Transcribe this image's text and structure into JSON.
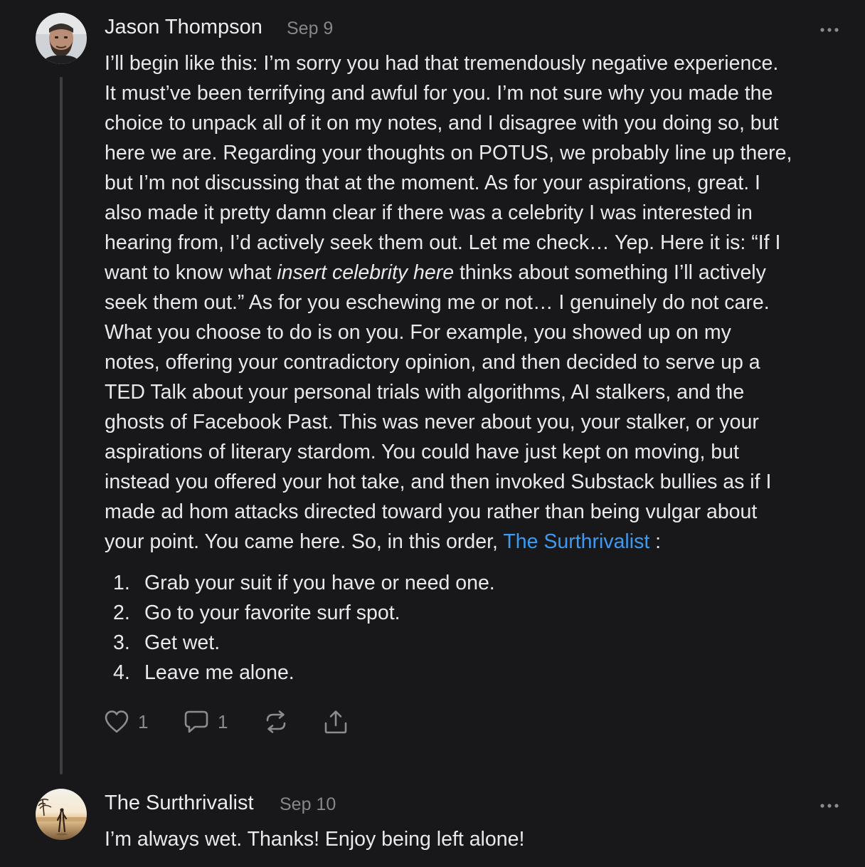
{
  "comments": [
    {
      "author": "Jason Thompson",
      "date": "Sep 9",
      "lines": [
        [
          "I’ll begin like this: I’m sorry you had that tremendously negative experience."
        ],
        [
          "It must’ve been terrifying and awful for you. I’m not sure why you made the"
        ],
        [
          "choice to unpack all of it on my notes, and I disagree with you doing so, but"
        ],
        [
          "here we are. Regarding your thoughts on POTUS, we probably line up there,"
        ],
        [
          "but I’m not discussing that at the moment. As for your aspirations, great. I"
        ],
        [
          "also made it pretty damn clear if there was a celebrity I was interested in"
        ],
        [
          "hearing from, I’d actively seek them out. Let me check… Yep. Here it is: “If I"
        ],
        [
          "want to know what ",
          "insert celebrity here",
          " thinks about something I’ll actively"
        ],
        [
          "seek them out.” As for you eschewing me or not… I genuinely do not care."
        ],
        [
          "What you choose to do is on you. For example, you showed up on my"
        ],
        [
          "notes, offering your contradictory opinion, and then decided to serve up a"
        ],
        [
          "TED Talk about your personal trials with algorithms, AI stalkers, and the"
        ],
        [
          "ghosts of Facebook Past. This was never about you, your stalker, or your"
        ],
        [
          "aspirations of literary stardom. You could have just kept on moving, but"
        ],
        [
          "instead you offered your hot take, and then invoked Substack bullies as if I"
        ],
        [
          "made ad hom attacks directed toward you rather than being vulgar about"
        ],
        [
          "your point. You came here. So, in this order, ",
          "The Surthrivalist",
          " :"
        ]
      ],
      "list": [
        {
          "num": "1.",
          "text": "Grab your suit if you have or need one."
        },
        {
          "num": "2.",
          "text": "Go to your favorite surf spot."
        },
        {
          "num": "3.",
          "text": "Get wet."
        },
        {
          "num": "4.",
          "text": "Leave me alone."
        }
      ],
      "likes": "1",
      "replies": "1"
    },
    {
      "author": "The Surthrivalist",
      "date": "Sep 10",
      "text": "I’m always wet. Thanks! Enjoy being left alone!"
    }
  ],
  "icons": {
    "like": "heart-icon",
    "reply": "speech-bubble-icon",
    "restack": "restack-icon",
    "share": "share-icon",
    "more": "ellipsis-icon"
  },
  "colors": {
    "background": "#18181a",
    "text": "#e9e9eb",
    "muted": "#86868b",
    "mention": "#3c9af2",
    "thread_line": "#3e3e42"
  }
}
